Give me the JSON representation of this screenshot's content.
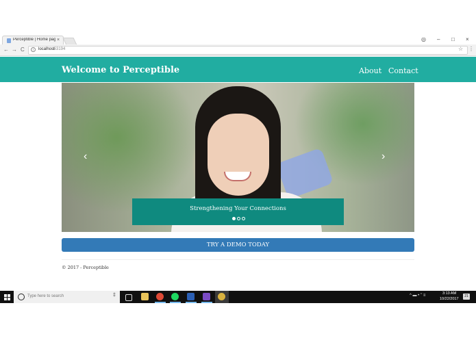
{
  "browser": {
    "tab_title": "Perceptible | Home page",
    "tab_close": "×",
    "back": "←",
    "forward": "→",
    "reload": "C",
    "url_host": "localhost",
    "url_port": ":63194",
    "star": "☆",
    "menu": "⋮",
    "window_account": "◎",
    "window_min": "–",
    "window_max": "□",
    "window_close": "×"
  },
  "site": {
    "title": "Welcome to Perceptible",
    "nav": {
      "about": "About",
      "contact": "Contact"
    },
    "carousel": {
      "caption": "Strengthening Your Connections",
      "prev": "‹",
      "next": "›",
      "active_slide": 1,
      "slide_count": 3
    },
    "cta_label": "TRY A DEMO TODAY",
    "footer": "© 2017 - Perceptible"
  },
  "taskbar": {
    "search_placeholder": "Type here to search",
    "mic": "‡",
    "tray": "^ ▬ • ’’ ≡",
    "time": "3:13 AM",
    "date": "10/22/2017",
    "notifications": "21"
  },
  "colors": {
    "header": "#21ada1",
    "caption_box": "#0f8a7f",
    "cta": "#337ab7",
    "taskbar": "#101010"
  }
}
